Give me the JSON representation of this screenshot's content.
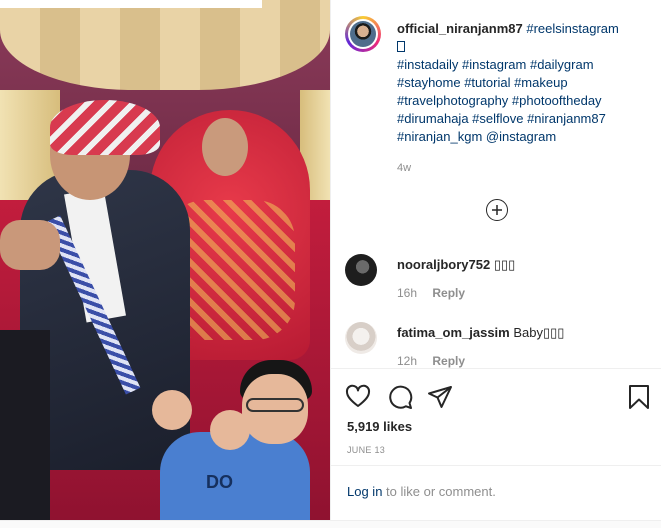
{
  "post": {
    "username": "official_niranjanm87",
    "caption_tags_line1": "#reelsinstagram",
    "caption_tags_rest": "#instadaily #instagram #dailygram #stayhome #tutorial #makeup #travelphotography #photooftheday #dirumahaja #selflove #niranjanm87 #niranjan_kgm @instagram",
    "time_ago": "4w"
  },
  "media": {
    "shirt_print": "DO"
  },
  "comments": [
    {
      "username": "nooraljbory752",
      "text": "▯▯▯",
      "time": "16h",
      "reply_label": "Reply"
    },
    {
      "username": "fatima_om_jassim",
      "text": "Baby▯▯▯",
      "time": "12h",
      "reply_label": "Reply"
    }
  ],
  "actions": {
    "likes": "5,919 likes",
    "date": "JUNE 13",
    "login_link": "Log in",
    "login_suffix": " to like or comment."
  },
  "icons": {
    "load_more": "plus-circle-icon",
    "like": "heart-icon",
    "comment": "comment-bubble-icon",
    "share": "paper-plane-icon",
    "save": "bookmark-icon"
  },
  "colors": {
    "link": "#00376b",
    "muted": "#8e8e8e",
    "text": "#262626",
    "divider": "#efefef"
  }
}
